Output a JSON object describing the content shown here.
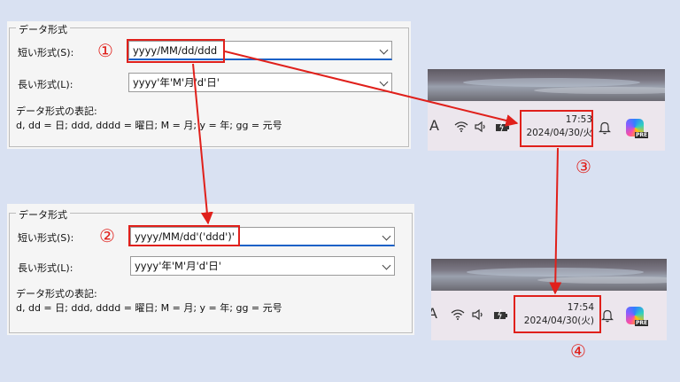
{
  "panel_top": {
    "legend": "データ形式",
    "short_label": "短い形式(S):",
    "short_value": "yyyy/MM/dd/ddd",
    "long_label": "長い形式(L):",
    "long_value": "yyyy'年'M'月'd'日'",
    "note_title": "データ形式の表記:",
    "note_body": "d, dd = 日;  ddd, dddd = 曜日; M = 月; y = 年; gg = 元号"
  },
  "panel_bottom": {
    "legend": "データ形式",
    "short_label": "短い形式(S):",
    "short_value": "yyyy/MM/dd'('ddd')'",
    "long_label": "長い形式(L):",
    "long_value": "yyyy'年'M'月'd'日'",
    "note_title": "データ形式の表記:",
    "note_body": "d, dd = 日;  ddd, dddd = 曜日; M = 月; y = 年; gg = 元号"
  },
  "taskbar_top": {
    "time": "17:53",
    "date": "2024/04/30/火",
    "pre_badge": "PRE",
    "letter": "A"
  },
  "taskbar_bottom": {
    "time": "17:54",
    "date": "2024/04/30(火)",
    "pre_badge": "PRE",
    "letter": "A"
  },
  "markers": {
    "m1": "①",
    "m2": "②",
    "m3": "③",
    "m4": "④"
  },
  "colors": {
    "highlight": "#e0201b",
    "focus": "#1a61c7",
    "background": "#d9e1f2"
  }
}
